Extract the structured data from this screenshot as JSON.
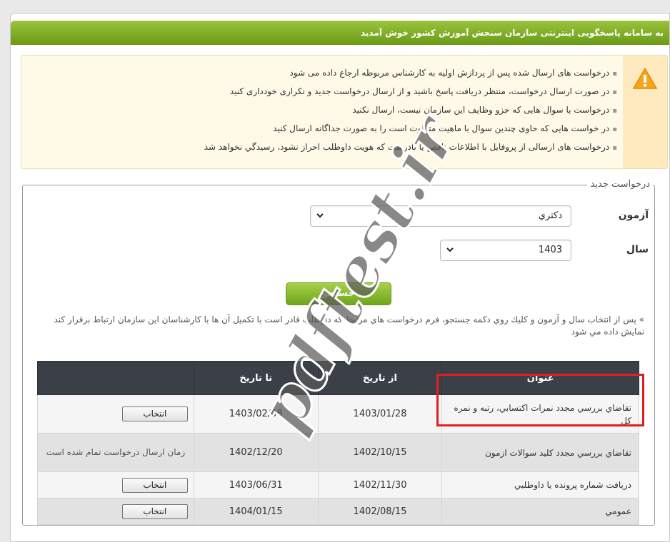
{
  "header": {
    "title": "به سامانه پاسخگويی اينترنتی سازمان سنجش آموزش کشور خوش آمديد"
  },
  "notice": {
    "items": [
      "درخواست های ارسال شده پس از پردازش اولیه به کارشناس مربوطه ارجاع داده می شود",
      "در صورت ارسال درخواست، منتظر دریافت پاسخ باشید و از ارسال درخواست جدید و تکراری خودداری کنید",
      "درخواست یا سوال هایی که جزو وظایف این سازمان نیست، ارسال نکنید",
      "در خواست هایی که حاوی چندین سوال با ماهیت متفاوت است را به صورت جداگانه ارسال کنید",
      "درخواست های ارسالی از پروفایل با اطلاعات ناقص یا نادرست که هویت داوطلب احراز نشود، رسیدگي نخواهد شد"
    ]
  },
  "form": {
    "legend": "درخواست جديد",
    "exam_label": "آزمون",
    "exam_value": "دكتري",
    "year_label": "سال",
    "year_value": "1403",
    "search_label": "جستجو",
    "hint": "» پس از انتخاب سال و آزمون و كليك روي دكمه جستجو، فرم درخواست هاي مرتبط كه داوطلب قادر است با تكميل آن ها با كارشناسان اين سازمان ارتباط برقرار كند نمايش داده مي شود"
  },
  "table": {
    "headers": {
      "title": "عنوان",
      "from": "از تاريخ",
      "to": "تا تاريخ",
      "action": ""
    },
    "rows": [
      {
        "title": "تقاضاي بررسي مجدد نمرات اكتسابي، رتبه و نمره كل",
        "from": "1403/01/28",
        "to": "1403/02/08",
        "action": "انتخاب"
      },
      {
        "title": "تقاضاي بررسي مجدد كليد سوالات ازمون",
        "from": "1402/10/15",
        "to": "1402/12/20",
        "action": "زمان ارسال درخواست تمام شده است"
      },
      {
        "title": "دريافت شماره پرونده يا داوطلبي",
        "from": "1402/11/30",
        "to": "1403/06/31",
        "action": "انتخاب"
      },
      {
        "title": "عمومي",
        "from": "1402/08/15",
        "to": "1404/01/15",
        "action": "انتخاب"
      }
    ]
  },
  "watermark": {
    "text": "pdftest.ir"
  }
}
